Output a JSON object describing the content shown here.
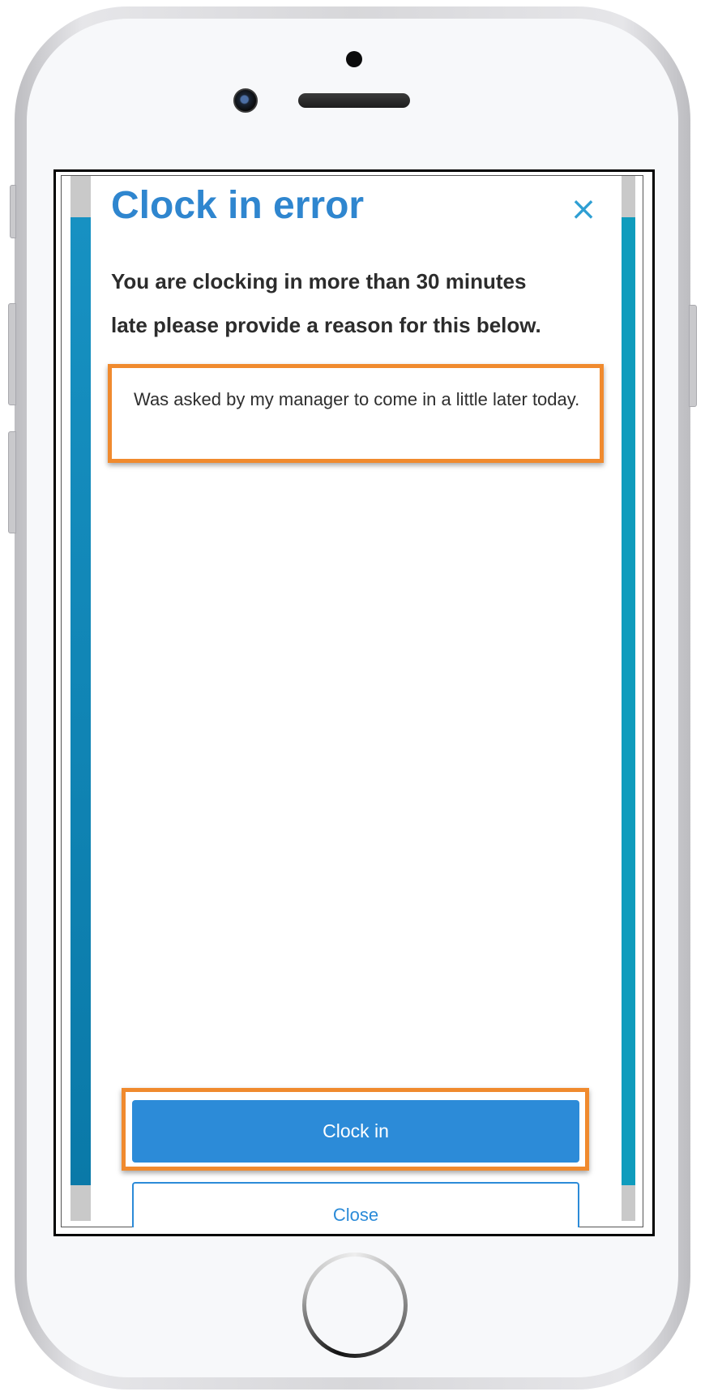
{
  "modal": {
    "title": "Clock in error",
    "close_icon": "close-icon",
    "message_line_1": "You are clocking in more than 30 minutes",
    "message_line_2": "late please provide a reason for this below.",
    "reason_value": "Was asked by my manager to come in a little later today.",
    "clock_in_label": "Clock in",
    "close_label": "Close"
  },
  "colors": {
    "title": "#2f86cf",
    "primary_button": "#2c8bd8",
    "highlight": "#f08a2e",
    "strip_left": "#0a79a8",
    "strip_right": "#0f9cbd"
  }
}
